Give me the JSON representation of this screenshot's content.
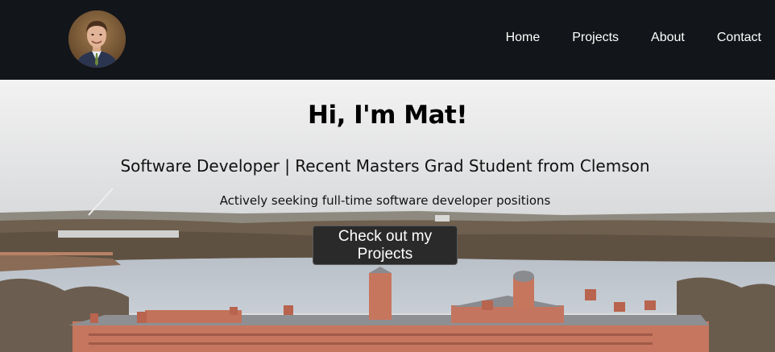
{
  "header": {
    "avatar_icon": "profile-photo",
    "nav": [
      {
        "label": "Home"
      },
      {
        "label": "Projects"
      },
      {
        "label": "About"
      },
      {
        "label": "Contact"
      }
    ]
  },
  "hero": {
    "title": "Hi, I'm Mat!",
    "subtitle": "Software Developer | Recent Masters Grad Student from Clemson",
    "note": "Actively seeking full-time software developer positions",
    "cta_label": "Check out my Projects",
    "background_image": "campus-lake-aerial-photo"
  },
  "colors": {
    "navbar_bg": "#121519",
    "nav_text": "#ffffff",
    "cta_bg": "#2a2a2a"
  }
}
